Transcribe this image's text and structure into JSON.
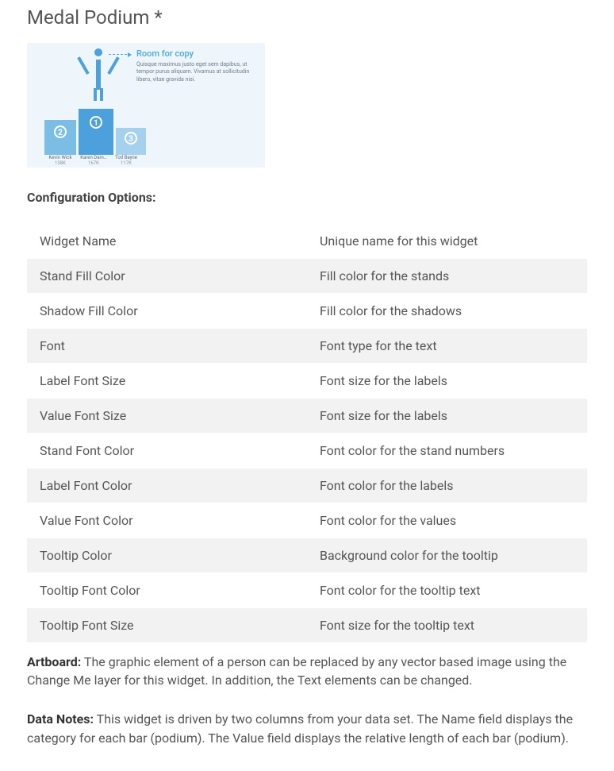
{
  "title": "Medal Podium *",
  "preview": {
    "copy_title": "Room for copy",
    "copy_body": "Quisque maximus justo eget sem dapibus, ut tempor purus aliquam. Vivamus at sollicitudin libero, vitae gravida nisi.",
    "stands": {
      "s1": "1",
      "s2": "2",
      "s3": "3"
    },
    "labels": [
      {
        "name": "Kevin Wick",
        "value": "138K"
      },
      {
        "name": "Karen Dam…",
        "value": "167K"
      },
      {
        "name": "Tod Bayne",
        "value": "117K"
      }
    ]
  },
  "section_label": "Configuration Options:",
  "options": [
    {
      "name": "Widget Name",
      "desc": "Unique name for this widget"
    },
    {
      "name": "Stand Fill Color",
      "desc": "Fill color for the stands"
    },
    {
      "name": "Shadow Fill Color",
      "desc": "Fill color for the shadows"
    },
    {
      "name": "Font",
      "desc": "Font type for the text"
    },
    {
      "name": "Label Font Size",
      "desc": "Font size for the labels"
    },
    {
      "name": "Value Font Size",
      "desc": "Font size for the labels"
    },
    {
      "name": "Stand Font Color",
      "desc": "Font color for the stand numbers"
    },
    {
      "name": "Label Font Color",
      "desc": "Font color for the labels"
    },
    {
      "name": "Value Font Color",
      "desc": "Font color for the values"
    },
    {
      "name": "Tooltip Color",
      "desc": "Background color for the tooltip"
    },
    {
      "name": "Tooltip Font Color",
      "desc": "Font color for the tooltip text"
    },
    {
      "name": "Tooltip Font Size",
      "desc": "Font size for the tooltip text"
    }
  ],
  "notes": {
    "artboard_label": "Artboard:",
    "artboard_text": "  The graphic element of a person can be replaced by any vector based image using the Change Me layer for this widget.  In addition, the Text elements can be changed.",
    "data_label": "Data Notes:",
    "data_text": "  This widget is driven by two columns from your data set.  The Name field displays the category for each bar (podium).  The Value field displays the relative length of each bar (podium)."
  }
}
